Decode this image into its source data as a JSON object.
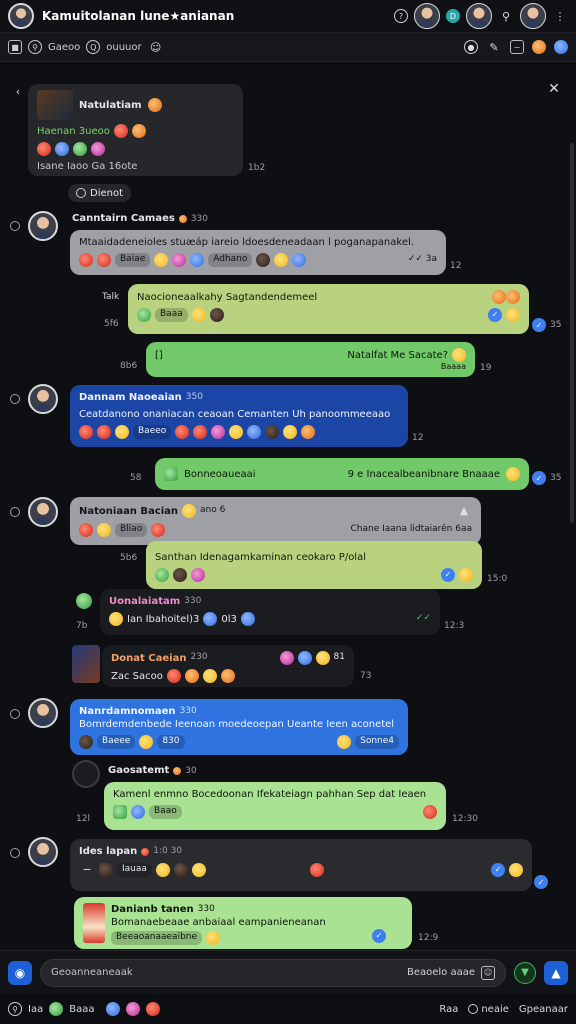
{
  "header": {
    "title": "Kamuitolanan lune★anianan"
  },
  "toolbar": {
    "label_1": "Gaeoo",
    "label_2": "ouuuor"
  },
  "chat": {
    "pinned": {
      "name": "Natulatiam",
      "line": "Haenan 3ueoo",
      "meta": "Isane  Iaoo  Ga  16ote",
      "time": "1b2"
    },
    "divider": "Dienot",
    "m1": {
      "sender": "Canntairn Camaes",
      "count": "330",
      "text": "Mtaaidadeneioles stuæáp iareio ldoesdeneadaan l poganapanakel.",
      "pill_a": "Baiae",
      "pill_b": "Adhano",
      "time": "12",
      "checks": "✓✓ 3a"
    },
    "m2": {
      "label": "Talk",
      "text": "Naocioneaalkahy Sagtandendemeel",
      "time_left": "5f6",
      "pill": "Baaa",
      "right_time": "35"
    },
    "m3": {
      "text_left": "[]",
      "text_right": "Natalfat  Me  Sacate?",
      "sub": "Baaaa",
      "time_left": "8b6",
      "time": "19"
    },
    "m4": {
      "sender": "Dannam Naoeaian",
      "count": "350",
      "text": "Ceatdanono onaniacan ceaoan Cemanten Uh panoommeeaao",
      "pill": "Baeeo",
      "time": "12"
    },
    "m5": {
      "text_left": "Bonneoaueaai",
      "text_right": "9  e  Inacealbeanibnare  Bnaaae",
      "time_left": "58",
      "time": "35"
    },
    "m6": {
      "sender": "Natoniaan Bacian",
      "count": "ano 6",
      "sub": "Bliao",
      "right_text": "Chane Iaana lidtaiarên 6aa",
      "time": "5b6"
    },
    "m7": {
      "text": "Santhan Idenagamkaminan ceokaro P/olal",
      "time": "15:0"
    },
    "m8": {
      "sender": "Uonalaiatam",
      "count": "330",
      "line": "Ian  Ibahoitel)3",
      "extra": "0l3",
      "time_left": "7b",
      "time": "12:3"
    },
    "m9": {
      "sender": "Donat Caeian",
      "count": "230",
      "line": "Zac Sacoo",
      "extra": "81",
      "time": "73"
    },
    "m10": {
      "sender": "Nanrdamnomaen",
      "count": "330",
      "text": "Bomrdemdenbede Ieenoan moedeoepan Ueante Ieen aconetel",
      "pill": "Baeee",
      "pill_b": "830",
      "right_pill": "Sonne4",
      "time": ""
    },
    "m11": {
      "sender": "Gaosatemt",
      "count": "30",
      "text": "Kamenl enmno Bocedoonan Ifekateiagn pahhan Sep dat Ieaen",
      "pill": "Baao",
      "time_left": "12l",
      "time": "12:30"
    },
    "m12": {
      "sender": "Ides lapan",
      "count": "1:0 30",
      "pill": "Iauaa",
      "time": ""
    },
    "m13": {
      "sender": "Danianb tanen",
      "count": "330",
      "text": "Bomanaebeaae anbaiaal eampanieneanan",
      "sub": "Beeaoanaaeaibne",
      "time": "12:9"
    }
  },
  "composer": {
    "placeholder": "Geoanneaneaak",
    "hint": "Beaoelo aaae"
  },
  "bottom": {
    "left_1": "Iaa",
    "left_2": "Baaa",
    "right_1": "Raa",
    "right_2": "neaie",
    "right_3": "Gpeanaar"
  },
  "colors": {
    "background": "#0e0f12",
    "bubble_blue": "#1c46a6",
    "bubble_blue_light": "#2e73e0",
    "bubble_green": "#72c96a",
    "bubble_lime": "#b9d27f",
    "bubble_gray": "#9ea0a6",
    "accent": "#3f7ff0"
  }
}
